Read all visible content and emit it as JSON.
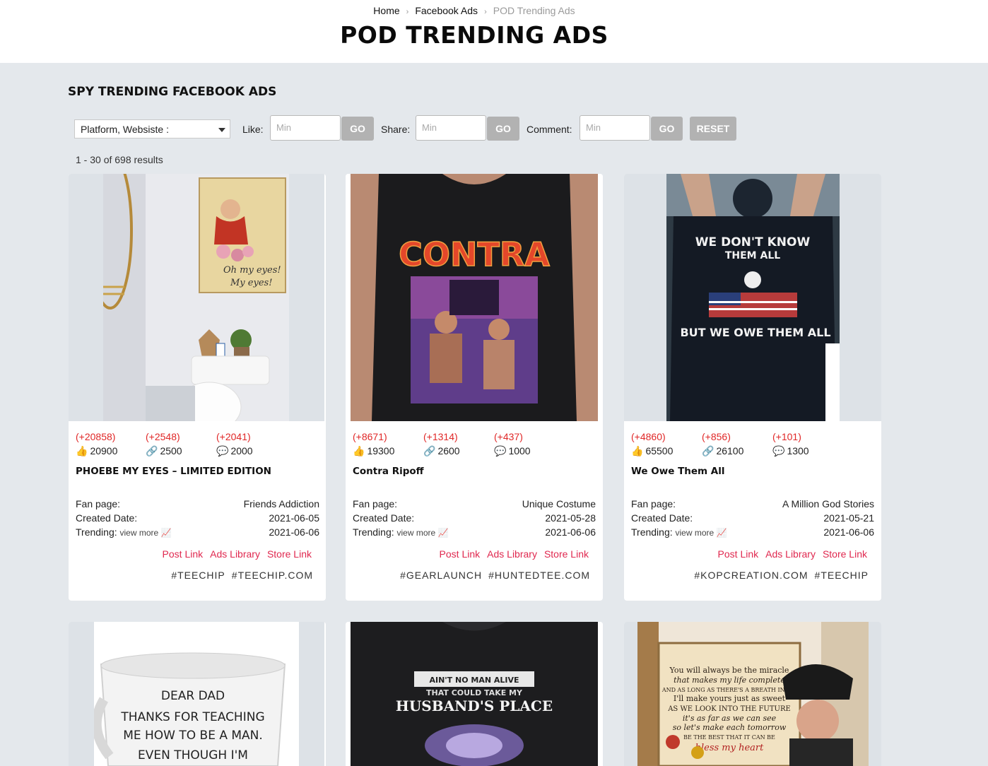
{
  "breadcrumb": {
    "home": "Home",
    "parent": "Facebook Ads",
    "current": "POD Trending Ads"
  },
  "page_title": "POD TRENDING ADS",
  "section_title": "SPY TRENDING FACEBOOK ADS",
  "filters": {
    "select_value": "Platform, Websiste :",
    "like_label": "Like:",
    "share_label": "Share:",
    "comment_label": "Comment:",
    "min_placeholder": "Min",
    "go_label": "GO",
    "reset_label": "RESET"
  },
  "results_text": "1 - 30 of 698 results",
  "labels": {
    "fan_page": "Fan page:",
    "created_date": "Created Date:",
    "trending": "Trending:",
    "view_more": "view more 📈",
    "post_link": "Post Link",
    "ads_library": "Ads Library",
    "store_link": "Store Link"
  },
  "icons": {
    "like": "thumbs-up-icon",
    "share": "link-icon",
    "comment": "speech-bubble-icon"
  },
  "cards": [
    {
      "like_delta": "(+20858)",
      "share_delta": "(+2548)",
      "comment_delta": "(+2041)",
      "likes": "20900",
      "shares": "2500",
      "comments": "2000",
      "title": "PHOEBE MY EYES – LIMITED EDITION",
      "fan_page": "Friends Addiction",
      "created_date": "2021-06-05",
      "trending_date": "2021-06-06",
      "tags": [
        "#TEECHIP",
        "#TEECHIP.COM"
      ]
    },
    {
      "like_delta": "(+8671)",
      "share_delta": "(+1314)",
      "comment_delta": "(+437)",
      "likes": "19300",
      "shares": "2600",
      "comments": "1000",
      "title": "Contra Ripoff",
      "fan_page": "Unique Costume",
      "created_date": "2021-05-28",
      "trending_date": "2021-06-06",
      "tags": [
        "#GEARLAUNCH",
        "#HUNTEDTEE.COM"
      ]
    },
    {
      "like_delta": "(+4860)",
      "share_delta": "(+856)",
      "comment_delta": "(+101)",
      "likes": "65500",
      "shares": "26100",
      "comments": "1300",
      "title": "We Owe Them All",
      "fan_page": "A Million God Stories",
      "created_date": "2021-05-21",
      "trending_date": "2021-06-06",
      "tags": [
        "#KOPCREATION.COM",
        "#TEECHIP"
      ]
    }
  ],
  "image_text": {
    "mug_lines": [
      "DEAR DAD",
      "THANKS FOR TEACHING",
      "ME HOW TO BE A MAN.",
      "EVEN THOUGH I'M"
    ],
    "poem_lines": [
      "You will always be the miracle",
      "that makes my life complete",
      "AND AS LONG AS THERE'S A BREATH IN ME",
      "I'll make yours just as sweet",
      "AS WE LOOK INTO THE FUTURE",
      "it's as far as we can see",
      "so let's make each tomorrow",
      "BE THE BEST THAT IT CAN BE",
      "bless my heart"
    ],
    "shirt_husband": [
      "AIN'T NO MAN ALIVE",
      "THAT COULD TAKE MY",
      "HUSBAND'S PLACE"
    ],
    "shirt_contra": "CONTRA",
    "shirt_owe": [
      "WE DON'T KNOW",
      "THEM ALL",
      "BUT WE OWE THEM ALL"
    ],
    "canvas_text": [
      "Oh my eyes!",
      "My eyes!"
    ]
  }
}
